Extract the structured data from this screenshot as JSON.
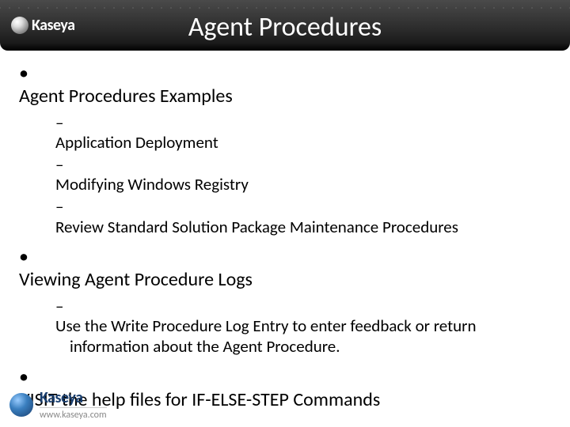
{
  "header": {
    "brand": "Kaseya",
    "title": "Agent Procedures"
  },
  "content": {
    "bullets": [
      {
        "text": "Agent Procedures Examples",
        "sub": [
          "Application Deployment",
          "Modifying Windows Registry",
          "Review Standard Solution Package Maintenance Procedures"
        ]
      },
      {
        "text": "Viewing Agent Procedure Logs",
        "sub": [
          "Use the Write Procedure Log Entry to enter feedback or return information about the Agent Procedure."
        ]
      },
      {
        "text": "VISIT the help files for IF-ELSE-STEP Commands",
        "sub": []
      }
    ]
  },
  "footer": {
    "brand": "Kaseya",
    "url": "www.kaseya.com"
  }
}
